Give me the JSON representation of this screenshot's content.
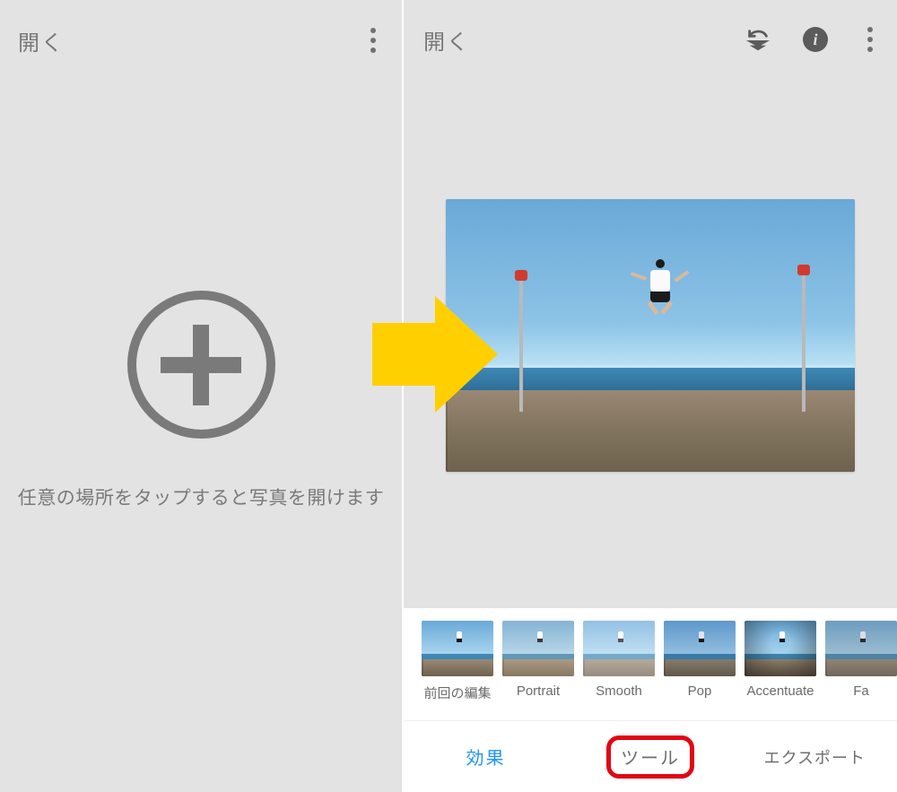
{
  "colors": {
    "accent_blue": "#2196f3",
    "highlight_red": "#e30613",
    "arrow_yellow": "#ffcf00",
    "neutral_text": "#7a7a7a"
  },
  "left": {
    "open_label": "開く",
    "tap_hint": "任意の場所をタップすると写真を開けます"
  },
  "right": {
    "open_label": "開く"
  },
  "presets": [
    {
      "key": "last_edit",
      "label": "前回の編集"
    },
    {
      "key": "portrait",
      "label": "Portrait"
    },
    {
      "key": "smooth",
      "label": "Smooth"
    },
    {
      "key": "pop",
      "label": "Pop"
    },
    {
      "key": "accentuate",
      "label": "Accentuate"
    },
    {
      "key": "fa",
      "label": "Fa"
    }
  ],
  "nav": {
    "effects": "効果",
    "tools": "ツール",
    "export": "エクスポート"
  }
}
